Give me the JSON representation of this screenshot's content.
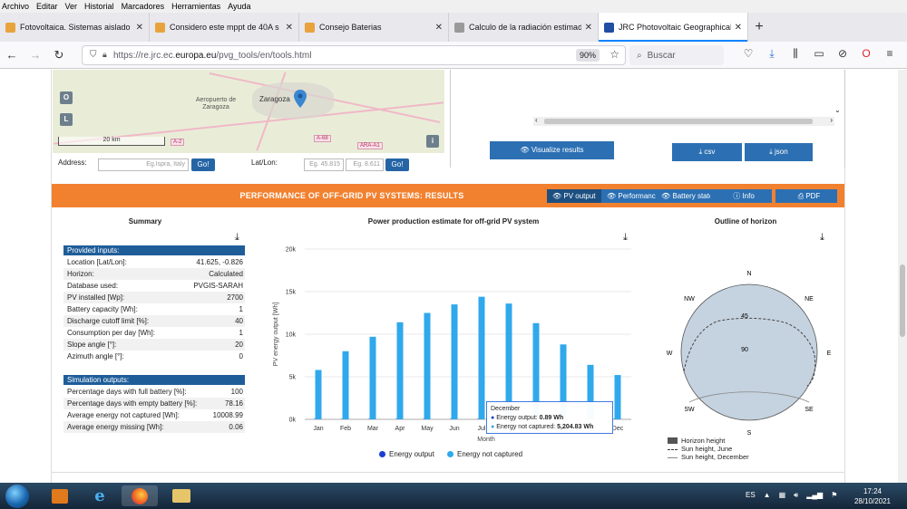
{
  "menu": [
    "Archivo",
    "Editar",
    "Ver",
    "Historial",
    "Marcadores",
    "Herramientas",
    "Ayuda"
  ],
  "tabs": [
    {
      "title": "Fotovoltaica. Sistemas aislado",
      "active": false,
      "color": "#e8a33d"
    },
    {
      "title": "Considero este mppt de 40A s",
      "active": false,
      "color": "#e8a33d"
    },
    {
      "title": "Consejo Baterias",
      "active": false,
      "color": "#e8a33d"
    },
    {
      "title": "Calculo de la radiación estimad",
      "active": false,
      "color": "#9a9a9a"
    },
    {
      "title": "JRC Photovoltaic Geographical",
      "active": true,
      "color": "#1f4ea3"
    }
  ],
  "nav": {
    "url_prefix": "https://re.jrc.ec.",
    "url_domain": "europa.eu",
    "url_path": "/pvg_tools/en/tools.html",
    "zoom": "90%",
    "search_placeholder": "Buscar"
  },
  "map": {
    "btn_o": "O",
    "btn_l": "L",
    "btn_i": "i",
    "scale": "20 km",
    "city": "Zaragoza",
    "airport": "Aeropuerto de Zaragoza",
    "roads": [
      "A-2",
      "A-68",
      "ARA-A1"
    ]
  },
  "address": {
    "label": "Address:",
    "placeholder": "Eg.Ispra, Italy",
    "go": "Go!",
    "latlon_label": "Lat/Lon:",
    "lat_placeholder": "Eg. 45.815",
    "lon_placeholder": "Eg. 8.611"
  },
  "actions": {
    "visualize": "Visualize results",
    "csv": "csv",
    "json": "json"
  },
  "results_bar": {
    "title": "PERFORMANCE OF OFF-GRID PV SYSTEMS: RESULTS",
    "buttons": [
      "PV output",
      "Performance",
      "Battery state",
      "Info",
      "PDF"
    ]
  },
  "summary": {
    "title": "Summary",
    "inputs_header": "Provided inputs:",
    "inputs": [
      {
        "label": "Location [Lat/Lon]:",
        "value": "41.625, -0.826"
      },
      {
        "label": "Horizon:",
        "value": "Calculated"
      },
      {
        "label": "Database used:",
        "value": "PVGIS-SARAH"
      },
      {
        "label": "PV installed [Wp]:",
        "value": "2700"
      },
      {
        "label": "Battery capacity [Wh]:",
        "value": "1"
      },
      {
        "label": "Discharge cutoff limit [%]:",
        "value": "40"
      },
      {
        "label": "Consumption per day [Wh]:",
        "value": "1"
      },
      {
        "label": "Slope angle [°]:",
        "value": "20"
      },
      {
        "label": "Azimuth angle [°]:",
        "value": "0"
      }
    ],
    "outputs_header": "Simulation outputs:",
    "outputs": [
      {
        "label": "Percentage days with full battery [%]:",
        "value": "100"
      },
      {
        "label": "Percentage days with empty battery [%]:",
        "value": "78.16"
      },
      {
        "label": "Average energy not captured [Wh]:",
        "value": "10008.99"
      },
      {
        "label": "Average energy missing [Wh]:",
        "value": "0.06"
      }
    ]
  },
  "chart_data": {
    "type": "bar",
    "title": "Power production estimate for off-grid PV system",
    "xlabel": "Month",
    "ylabel": "PV energy output [Wh]",
    "categories": [
      "Jan",
      "Feb",
      "Mar",
      "Apr",
      "May",
      "Jun",
      "Jul",
      "Aug",
      "Sep",
      "Oct",
      "Nov",
      "Dec"
    ],
    "ylim": [
      0,
      20000
    ],
    "yticks": [
      "0k",
      "5k",
      "10k",
      "15k",
      "20k"
    ],
    "series": [
      {
        "name": "Energy output",
        "color": "#1a3fd0",
        "values": [
          0.9,
          0.9,
          0.9,
          0.9,
          0.9,
          0.9,
          0.9,
          0.9,
          0.9,
          0.9,
          0.9,
          0.89
        ]
      },
      {
        "name": "Energy not captured",
        "color": "#30a8ec",
        "values": [
          5800,
          8000,
          9700,
          11400,
          12500,
          13500,
          14400,
          13600,
          11300,
          8800,
          6400,
          5204.83
        ]
      }
    ],
    "grid": true,
    "legend": "bottom",
    "tooltip": {
      "category": "December",
      "line1_label": "Energy output:",
      "line1_value": "0.89 Wh",
      "line2_label": "Energy not captured:",
      "line2_value": "5,204.83 Wh"
    }
  },
  "horizon": {
    "title": "Outline of horizon",
    "compass": [
      "N",
      "NE",
      "E",
      "SE",
      "S",
      "SW",
      "W",
      "NW"
    ],
    "rings": [
      "45",
      "90"
    ],
    "legend": [
      "Horizon height",
      "Sun height, June",
      "Sun height, December"
    ]
  },
  "taskbar": {
    "lang": "ES",
    "time": "17:24",
    "date": "28/10/2021"
  }
}
